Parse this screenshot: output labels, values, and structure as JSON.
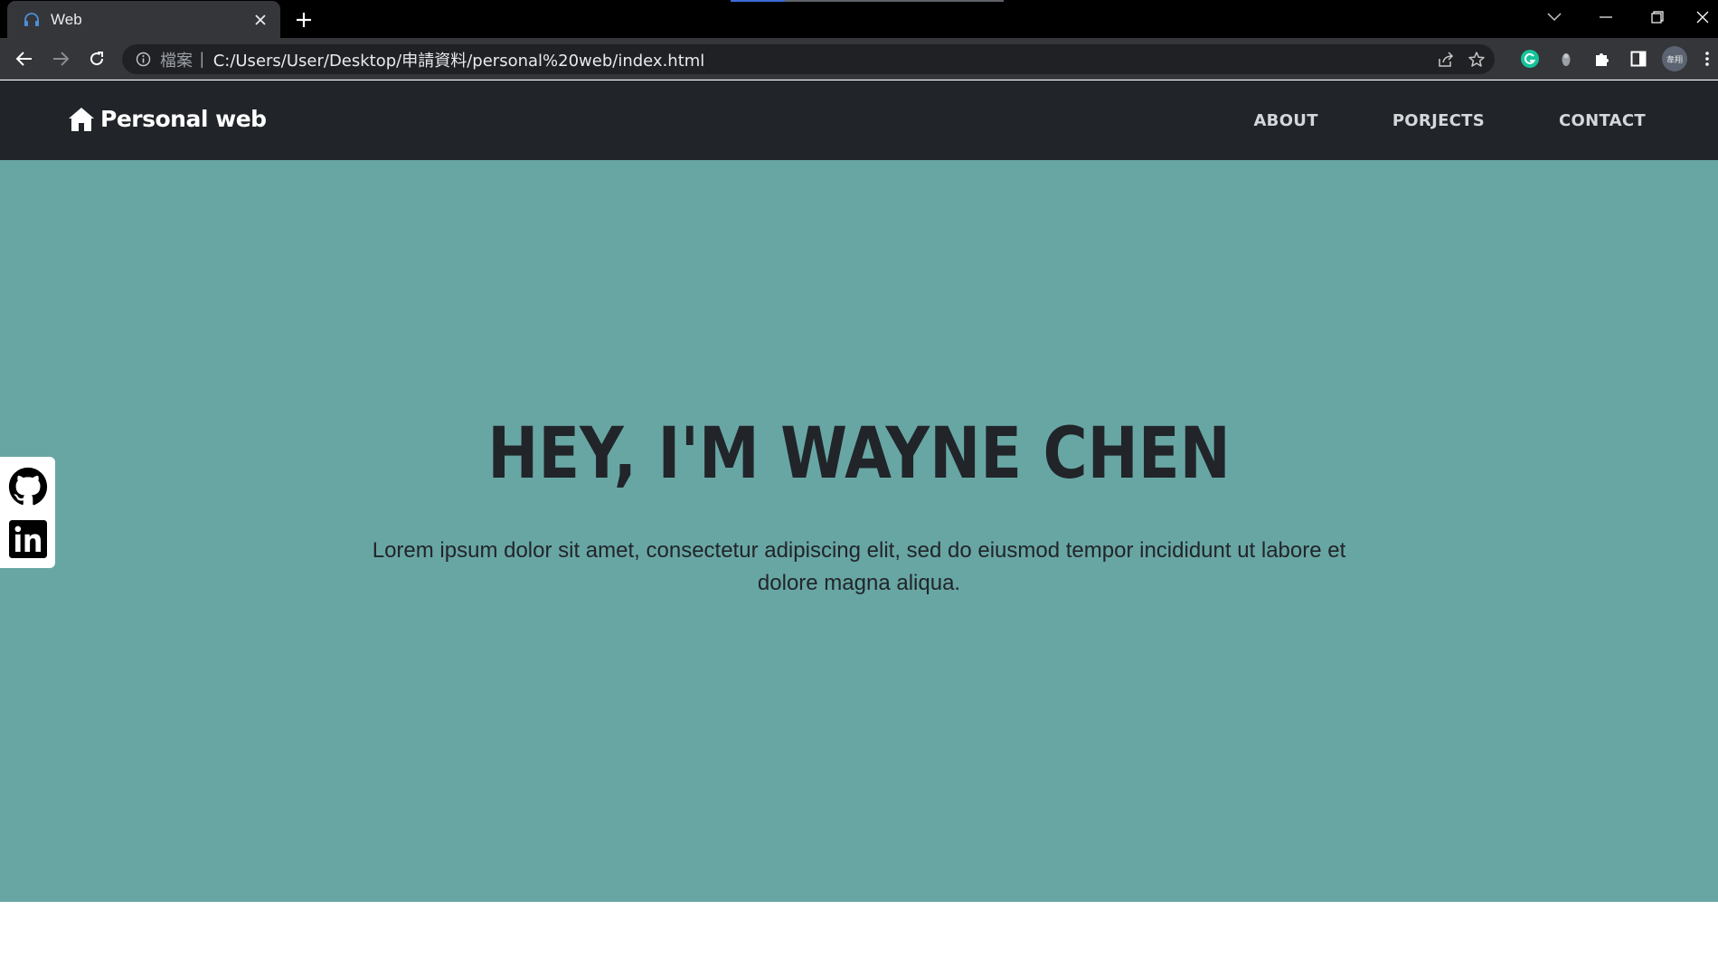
{
  "browser": {
    "tab": {
      "title": "Web",
      "favicon": "headphones-icon"
    },
    "address": {
      "scheme_label": "檔案",
      "url": "C:/Users/User/Desktop/申請資料/personal%20web/index.html"
    },
    "profile_label": "韋翔",
    "colors": {
      "tab_bg": "#35363a",
      "frame_bg": "#000000",
      "omnibox_bg": "#202124",
      "grammarly": "#15c39a"
    }
  },
  "site": {
    "brand": "Personal web",
    "nav": [
      {
        "label": "ABOUT"
      },
      {
        "label": "PORJECTS"
      },
      {
        "label": "CONTACT"
      }
    ],
    "hero": {
      "title": "HEY, I'M WAYNE CHEN",
      "subtitle": "Lorem ipsum dolor sit amet, consectetur adipiscing elit, sed do eiusmod tempor incididunt ut labore et dolore magna aliqua."
    },
    "social": [
      {
        "name": "github-icon"
      },
      {
        "name": "linkedin-icon"
      }
    ],
    "colors": {
      "nav_bg": "#212529",
      "hero_bg": "#68a6a4",
      "text_dark": "#212529"
    }
  }
}
